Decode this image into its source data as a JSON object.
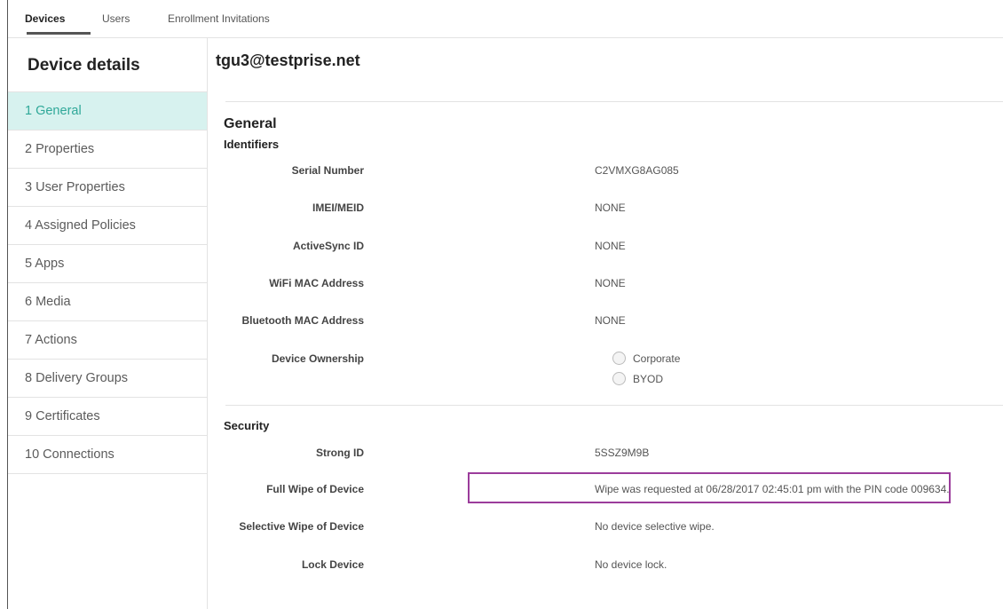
{
  "tabs": [
    {
      "label": "Devices",
      "active": true
    },
    {
      "label": "Users",
      "active": false
    },
    {
      "label": "Enrollment Invitations",
      "active": false
    }
  ],
  "sidebar": {
    "title": "Device details",
    "items": [
      {
        "label": "1 General",
        "active": true
      },
      {
        "label": "2 Properties"
      },
      {
        "label": "3 User Properties"
      },
      {
        "label": "4 Assigned Policies"
      },
      {
        "label": "5 Apps"
      },
      {
        "label": "6 Media"
      },
      {
        "label": "7 Actions"
      },
      {
        "label": "8 Delivery Groups"
      },
      {
        "label": "9 Certificates"
      },
      {
        "label": "10 Connections"
      }
    ]
  },
  "main": {
    "device_email": "tgu3@testprise.net",
    "section_title": "General",
    "identifiers": {
      "heading": "Identifiers",
      "serial_number": {
        "label": "Serial Number",
        "value": "C2VMXG8AG085"
      },
      "imei_meid": {
        "label": "IMEI/MEID",
        "value": "NONE"
      },
      "activesync_id": {
        "label": "ActiveSync ID",
        "value": "NONE"
      },
      "wifi_mac": {
        "label": "WiFi MAC Address",
        "value": "NONE"
      },
      "bluetooth_mac": {
        "label": "Bluetooth MAC Address",
        "value": "NONE"
      },
      "ownership": {
        "label": "Device Ownership",
        "options": [
          "Corporate",
          "BYOD"
        ]
      }
    },
    "security": {
      "heading": "Security",
      "strong_id": {
        "label": "Strong ID",
        "value": "5SSZ9M9B"
      },
      "full_wipe": {
        "label": "Full Wipe of Device",
        "value": "Wipe was requested at 06/28/2017 02:45:01 pm with the PIN code 009634."
      },
      "selective_wipe": {
        "label": "Selective Wipe of Device",
        "value": "No device selective wipe."
      },
      "lock_device": {
        "label": "Lock Device",
        "value": "No device lock."
      }
    }
  },
  "colors": {
    "active_item_bg": "#d7f2ef",
    "active_item_text": "#2fa899",
    "highlight_border": "#9b3c9b"
  }
}
